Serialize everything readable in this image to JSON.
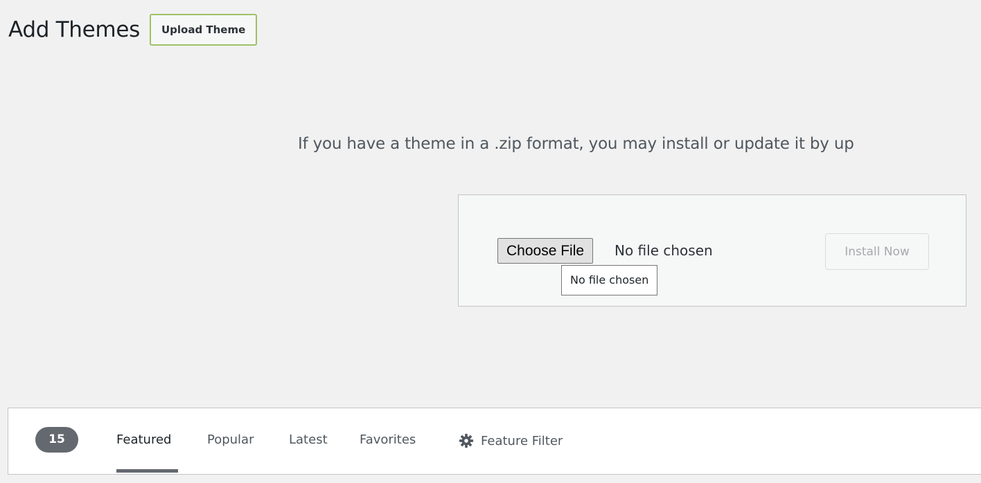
{
  "header": {
    "title": "Add Themes",
    "upload_theme_label": "Upload Theme"
  },
  "upload": {
    "intro_text": "If you have a theme in a .zip format, you may install or update it by up",
    "choose_file_label": "Choose File",
    "file_status": "No file chosen",
    "tooltip_text": "No file chosen",
    "install_label": "Install Now"
  },
  "filter_bar": {
    "count": "15",
    "tabs": [
      {
        "label": "Featured",
        "active": true
      },
      {
        "label": "Popular",
        "active": false
      },
      {
        "label": "Latest",
        "active": false
      },
      {
        "label": "Favorites",
        "active": false
      }
    ],
    "feature_filter_label": "Feature Filter",
    "feature_filter_icon": "gear-icon"
  },
  "colors": {
    "background": "#f1f1f1",
    "upload_button_border": "#9ec266",
    "badge": "#646970",
    "active_underline": "#646970"
  }
}
